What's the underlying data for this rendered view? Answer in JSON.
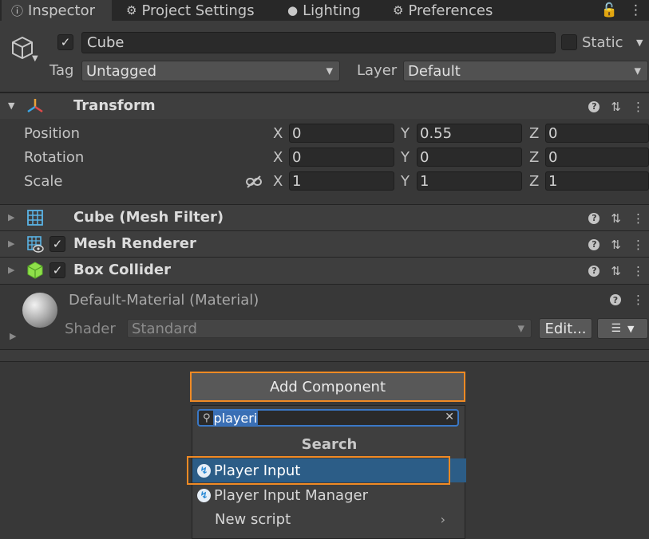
{
  "tabs": [
    {
      "label": "Inspector",
      "icon": "info-icon"
    },
    {
      "label": "Project Settings",
      "icon": "gear-icon"
    },
    {
      "label": "Lighting",
      "icon": "bulb-icon"
    },
    {
      "label": "Preferences",
      "icon": "gear-icon"
    }
  ],
  "object": {
    "name": "Cube",
    "active": true,
    "static_label": "Static",
    "tag_label": "Tag",
    "tag_value": "Untagged",
    "layer_label": "Layer",
    "layer_value": "Default"
  },
  "transform": {
    "title": "Transform",
    "rows": [
      {
        "label": "Position",
        "x": "0",
        "y": "0.55",
        "z": "0"
      },
      {
        "label": "Rotation",
        "x": "0",
        "y": "0",
        "z": "0"
      },
      {
        "label": "Scale",
        "x": "1",
        "y": "1",
        "z": "1"
      }
    ],
    "axis_x": "X",
    "axis_y": "Y",
    "axis_z": "Z"
  },
  "components": [
    {
      "name": "Cube (Mesh Filter)",
      "icon": "mesh-filter-icon",
      "has_checkbox": false
    },
    {
      "name": "Mesh Renderer",
      "icon": "mesh-renderer-icon",
      "has_checkbox": true
    },
    {
      "name": "Box Collider",
      "icon": "box-collider-icon",
      "has_checkbox": true
    }
  ],
  "material": {
    "name": "Default-Material (Material)",
    "shader_label": "Shader",
    "shader_value": "Standard",
    "edit_label": "Edit..."
  },
  "add_component": {
    "button_label": "Add Component",
    "search_value": "playeri",
    "section_title": "Search",
    "items": [
      {
        "label": "Player Input",
        "selected": true
      },
      {
        "label": "Player Input Manager",
        "selected": false
      },
      {
        "label": "New script",
        "selected": false
      }
    ]
  },
  "colors": {
    "highlight": "#f08a24",
    "selection": "#2c5d87",
    "search_focus": "#3a78c6"
  }
}
